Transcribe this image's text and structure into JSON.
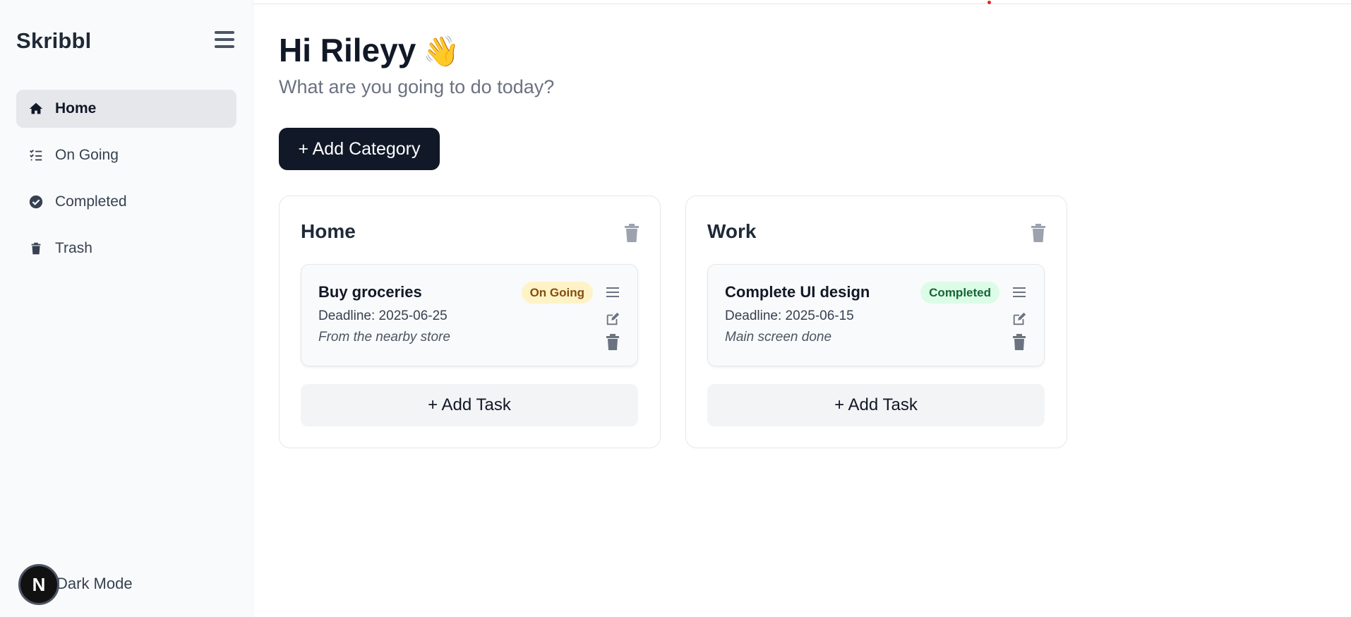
{
  "app": {
    "name": "Skribbl"
  },
  "sidebar": {
    "items": [
      {
        "label": "Home",
        "icon": "home-icon",
        "active": true
      },
      {
        "label": "On Going",
        "icon": "list-check-icon",
        "active": false
      },
      {
        "label": "Completed",
        "icon": "check-circle-icon",
        "active": false
      },
      {
        "label": "Trash",
        "icon": "trash-icon",
        "active": false
      }
    ],
    "dark_mode_label": "Dark Mode",
    "next_badge": "N"
  },
  "header": {
    "greeting": "Hi Rileyy",
    "wave": "👋",
    "subtitle": "What are you going to do today?"
  },
  "actions": {
    "add_category": "+ Add Category"
  },
  "categories": [
    {
      "title": "Home",
      "add_task_label": "+ Add Task",
      "tasks": [
        {
          "title": "Buy groceries",
          "status": "On Going",
          "deadline": "Deadline: 2025-06-25",
          "description": "From the nearby store"
        }
      ]
    },
    {
      "title": "Work",
      "add_task_label": "+ Add Task",
      "tasks": [
        {
          "title": "Complete UI design",
          "status": "Completed",
          "deadline": "Deadline: 2025-06-15",
          "description": "Main screen done"
        }
      ]
    }
  ],
  "colors": {
    "primary_button": "#111827",
    "ongoing_badge_bg": "#fef3c7",
    "completed_badge_bg": "#dcfce7"
  }
}
